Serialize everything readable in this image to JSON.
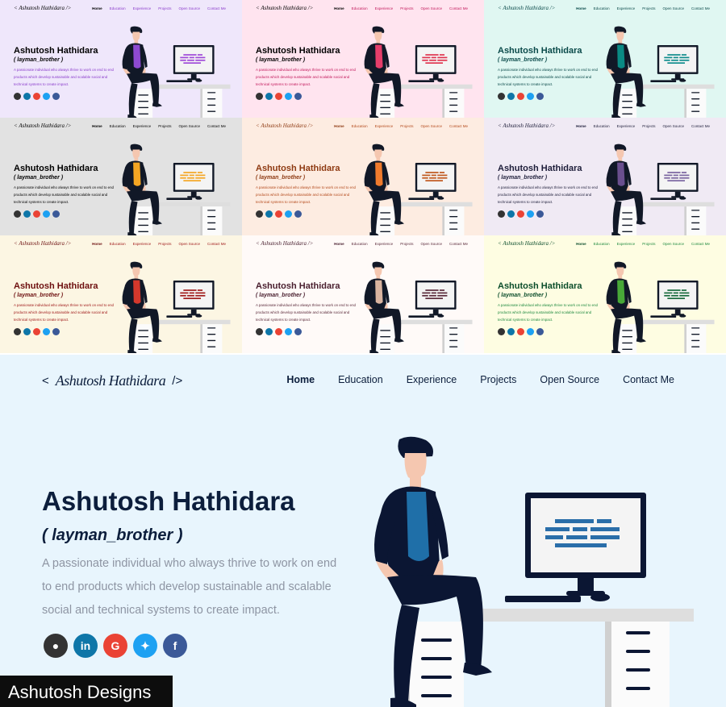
{
  "logo": {
    "prefix": "<",
    "signature": "Ashutosh Hathidara",
    "suffix": "/>"
  },
  "nav": [
    "Home",
    "Education",
    "Experience",
    "Projects",
    "Open Source",
    "Contact Me"
  ],
  "profile": {
    "name": "Ashutosh Hathidara",
    "nickname": "( layman_brother )",
    "description": "A passionate individual who always thrive to work on end to end products which develop sustainable and scalable social and technical systems to create impact."
  },
  "social_icons": [
    {
      "icon": "github-icon",
      "glyph": "●",
      "color": "#333333"
    },
    {
      "icon": "linkedin-icon",
      "glyph": "in",
      "color": "#0e76a8"
    },
    {
      "icon": "google-icon",
      "glyph": "G",
      "color": "#ea4335"
    },
    {
      "icon": "twitter-icon",
      "glyph": "✦",
      "color": "#1da1f2"
    },
    {
      "icon": "facebook-icon",
      "glyph": "f",
      "color": "#3b5998"
    }
  ],
  "themes": [
    {
      "bg": "#efe7fb",
      "text": "#000000",
      "accent": "#8b3dcc",
      "shirt": "#8e4ad1",
      "screen": "#9f4ad8",
      "active": "#000000"
    },
    {
      "bg": "#ffe4ef",
      "text": "#000000",
      "accent": "#c2185b",
      "shirt": "#e53e6a",
      "screen": "#e0344f",
      "active": "#000000"
    },
    {
      "bg": "#e0f7f2",
      "text": "#0a4a4a",
      "accent": "#0a4a4a",
      "shirt": "#0a8a84",
      "screen": "#0f8c8c",
      "active": "#0a4a4a"
    },
    {
      "bg": "#e2e2e2",
      "text": "#000000",
      "accent": "#000000",
      "shirt": "#f5a623",
      "screen": "#f5a623",
      "active": "#000000"
    },
    {
      "bg": "#fdece1",
      "text": "#8e3a12",
      "accent": "#b44a1c",
      "shirt": "#f07b2d",
      "screen": "#c0571c",
      "active": "#8e3a12"
    },
    {
      "bg": "#f0eaf4",
      "text": "#1e1e3a",
      "accent": "#1e1e3a",
      "shirt": "#6a4f8e",
      "screen": "#7a65a0",
      "active": "#1e1e3a"
    },
    {
      "bg": "#fcf6e3",
      "text": "#6d0f0f",
      "accent": "#a01b1b",
      "shirt": "#d4382c",
      "screen": "#a01b1b",
      "active": "#6d0f0f"
    },
    {
      "bg": "#fffaf8",
      "text": "#4a2030",
      "accent": "#5a2a3a",
      "shirt": "#d9b4a0",
      "screen": "#5a2a3a",
      "active": "#4a2030"
    },
    {
      "bg": "#fefde2",
      "text": "#0b4d2b",
      "accent": "#1f8a3f",
      "shirt": "#48a838",
      "screen": "#176a3c",
      "active": "#0b4d2b"
    }
  ],
  "hero_theme": {
    "bg": "#e8f5fd",
    "text": "#0c1e3c",
    "desc": "#8e95a3",
    "shirt": "#1f6fa8",
    "screen": "#2a6ea9"
  },
  "credit": "Ashutosh Designs"
}
